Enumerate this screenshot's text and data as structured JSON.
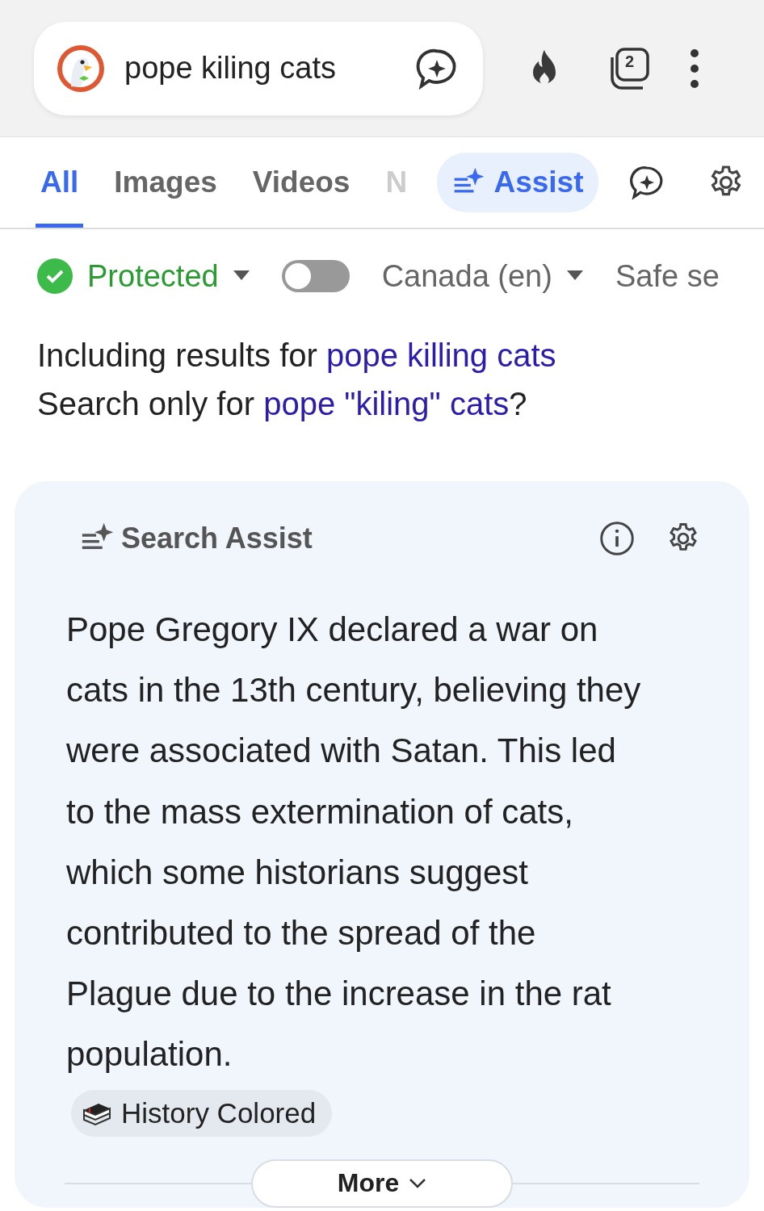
{
  "address_bar": {
    "query": "pope kiling cats"
  },
  "tab_count": "2",
  "tabs": [
    {
      "label": "All",
      "kind": "text",
      "selected": true
    },
    {
      "label": "Images",
      "kind": "text",
      "selected": false
    },
    {
      "label": "Videos",
      "kind": "text",
      "selected": false
    },
    {
      "label": "N",
      "kind": "faded",
      "selected": false
    },
    {
      "label": "Assist",
      "kind": "assist",
      "selected": false
    }
  ],
  "filters": [
    {
      "kind": "protection",
      "label": "Protected"
    },
    {
      "kind": "toggle",
      "on": false
    },
    {
      "kind": "dropdown",
      "label": "Canada (en)"
    },
    {
      "kind": "plain",
      "label": "Safe se"
    }
  ],
  "corrections": [
    {
      "prefix": "Including results for ",
      "link": "pope killing cats"
    },
    {
      "prefix": "Search only for ",
      "link": "pope \"kiling\" cats",
      "suffix": "?"
    }
  ],
  "assist": {
    "title": "Search Assist",
    "answer": "Pope Gregory IX declared a war on cats in the 13th century, believing they were associated with Satan. This led to the mass extermination of cats, which some historians suggest contributed to the spread of the Plague due to the increase in the rat population.",
    "source": "History Colored",
    "more": "More"
  }
}
